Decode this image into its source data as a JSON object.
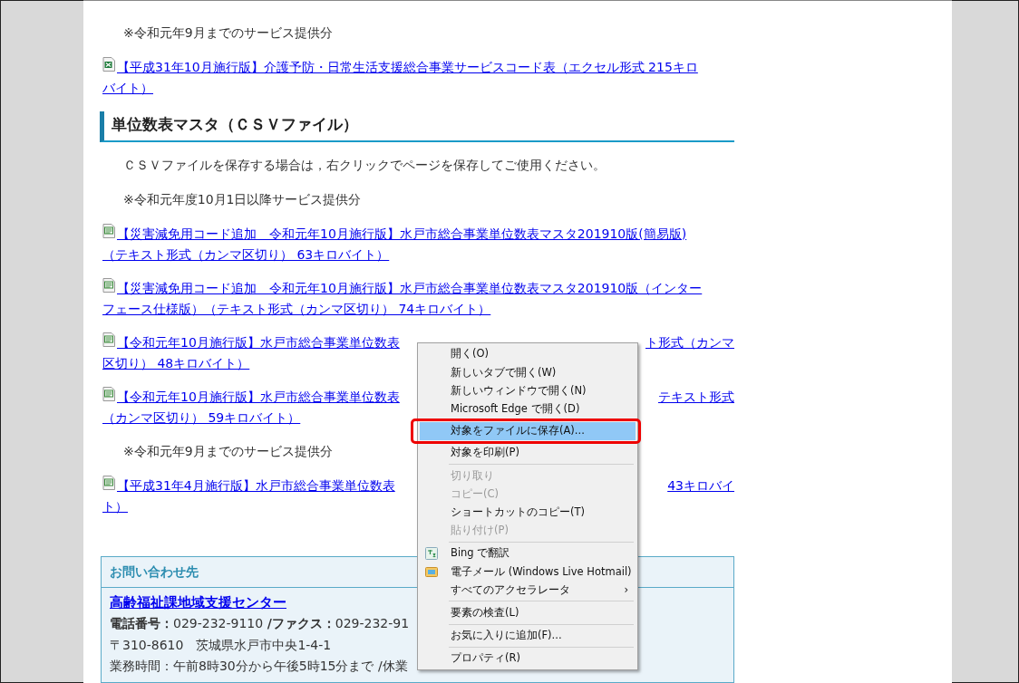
{
  "blocks": [
    {
      "kind": "note",
      "text": "※令和元年9月までのサービス提供分"
    },
    {
      "kind": "excel_link",
      "lines": [
        {
          "left": "【平成31年10月施行版】介護予防・日常生活支援総合事業サービスコード表（エクセル形式 215キロ"
        },
        {
          "left": "バイト）"
        }
      ]
    },
    {
      "kind": "heading",
      "text": "単位数表マスタ（ＣＳＶファイル）"
    },
    {
      "kind": "note",
      "text": "ＣＳＶファイルを保存する場合は，右クリックでページを保存してご使用ください。"
    },
    {
      "kind": "note",
      "text": "※令和元年度10月1日以降サービス提供分"
    },
    {
      "kind": "csv_link",
      "lines": [
        {
          "left": "【災害減免用コード追加　令和元年10月施行版】水戸市総合事業単位数表マスタ201910版(簡易版)"
        },
        {
          "left": "（テキスト形式（カンマ区切り） 63キロバイト）"
        }
      ]
    },
    {
      "kind": "csv_link",
      "lines": [
        {
          "left": "【災害減免用コード追加　令和元年10月施行版】水戸市総合事業単位数表マスタ201910版（インター"
        },
        {
          "left": "フェース仕様版）（テキスト形式（カンマ区切り） 74キロバイト）"
        }
      ]
    },
    {
      "kind": "csv_link",
      "lines": [
        {
          "left": "【令和元年10月施行版】水戸市総合事業単位数表",
          "right": "ト形式（カンマ"
        },
        {
          "left": "区切り） 48キロバイト）"
        }
      ]
    },
    {
      "kind": "csv_link",
      "lines": [
        {
          "left": "【令和元年10月施行版】水戸市総合事業単位数表",
          "right": "テキスト形式"
        },
        {
          "left": "（カンマ区切り） 59キロバイト）"
        }
      ]
    },
    {
      "kind": "note",
      "text": "※令和元年9月までのサービス提供分"
    },
    {
      "kind": "csv_link",
      "lines": [
        {
          "left": "【平成31年4月施行版】水戸市総合事業単位数表",
          "right": "43キロバイ"
        },
        {
          "left": "ト）"
        }
      ]
    }
  ],
  "contact": {
    "title": "お問い合わせ先",
    "office": "高齢福祉課地域支援センター",
    "phone": "**電話番号：**029-232-9110 **/ファクス：**029-232-91",
    "address": "〒310-8610　茨城県水戸市中央1-4-1",
    "hours": "業務時間：午前8時30分から午後5時15分まで /休業"
  },
  "context_menu": [
    {
      "kind": "item",
      "label": "開く(O)",
      "disabled": false,
      "selected": false
    },
    {
      "kind": "item",
      "label": "新しいタブで開く(W)",
      "disabled": false,
      "selected": false
    },
    {
      "kind": "item",
      "label": "新しいウィンドウで開く(N)",
      "disabled": false,
      "selected": false
    },
    {
      "kind": "item",
      "label": "Microsoft Edge で開く(D)",
      "disabled": false,
      "selected": false
    },
    {
      "kind": "item",
      "label": "対象をファイルに保存(A)...",
      "disabled": false,
      "selected": true,
      "outlined": true
    },
    {
      "kind": "item",
      "label": "対象を印刷(P)",
      "disabled": false,
      "selected": false
    },
    {
      "kind": "separator"
    },
    {
      "kind": "item",
      "label": "切り取り",
      "disabled": true,
      "selected": false
    },
    {
      "kind": "item",
      "label": "コピー(C)",
      "disabled": true,
      "selected": false
    },
    {
      "kind": "item",
      "label": "ショートカットのコピー(T)",
      "disabled": false,
      "selected": false
    },
    {
      "kind": "item",
      "label": "貼り付け(P)",
      "disabled": true,
      "selected": false
    },
    {
      "kind": "separator"
    },
    {
      "kind": "translate_item",
      "label": "Bing で翻訳",
      "disabled": false,
      "selected": false
    },
    {
      "kind": "mail_item",
      "label": "電子メール (Windows Live Hotmail)",
      "disabled": false,
      "selected": false
    },
    {
      "kind": "item",
      "label": "すべてのアクセラレータ",
      "submenu": "›",
      "disabled": false,
      "selected": false
    },
    {
      "kind": "separator"
    },
    {
      "kind": "item",
      "label": "要素の検査(L)",
      "disabled": false,
      "selected": false
    },
    {
      "kind": "separator"
    },
    {
      "kind": "item",
      "label": "お気に入りに追加(F)...",
      "disabled": false,
      "selected": false
    },
    {
      "kind": "separator"
    },
    {
      "kind": "item",
      "label": "プロパティ(R)",
      "disabled": false,
      "selected": false
    }
  ]
}
